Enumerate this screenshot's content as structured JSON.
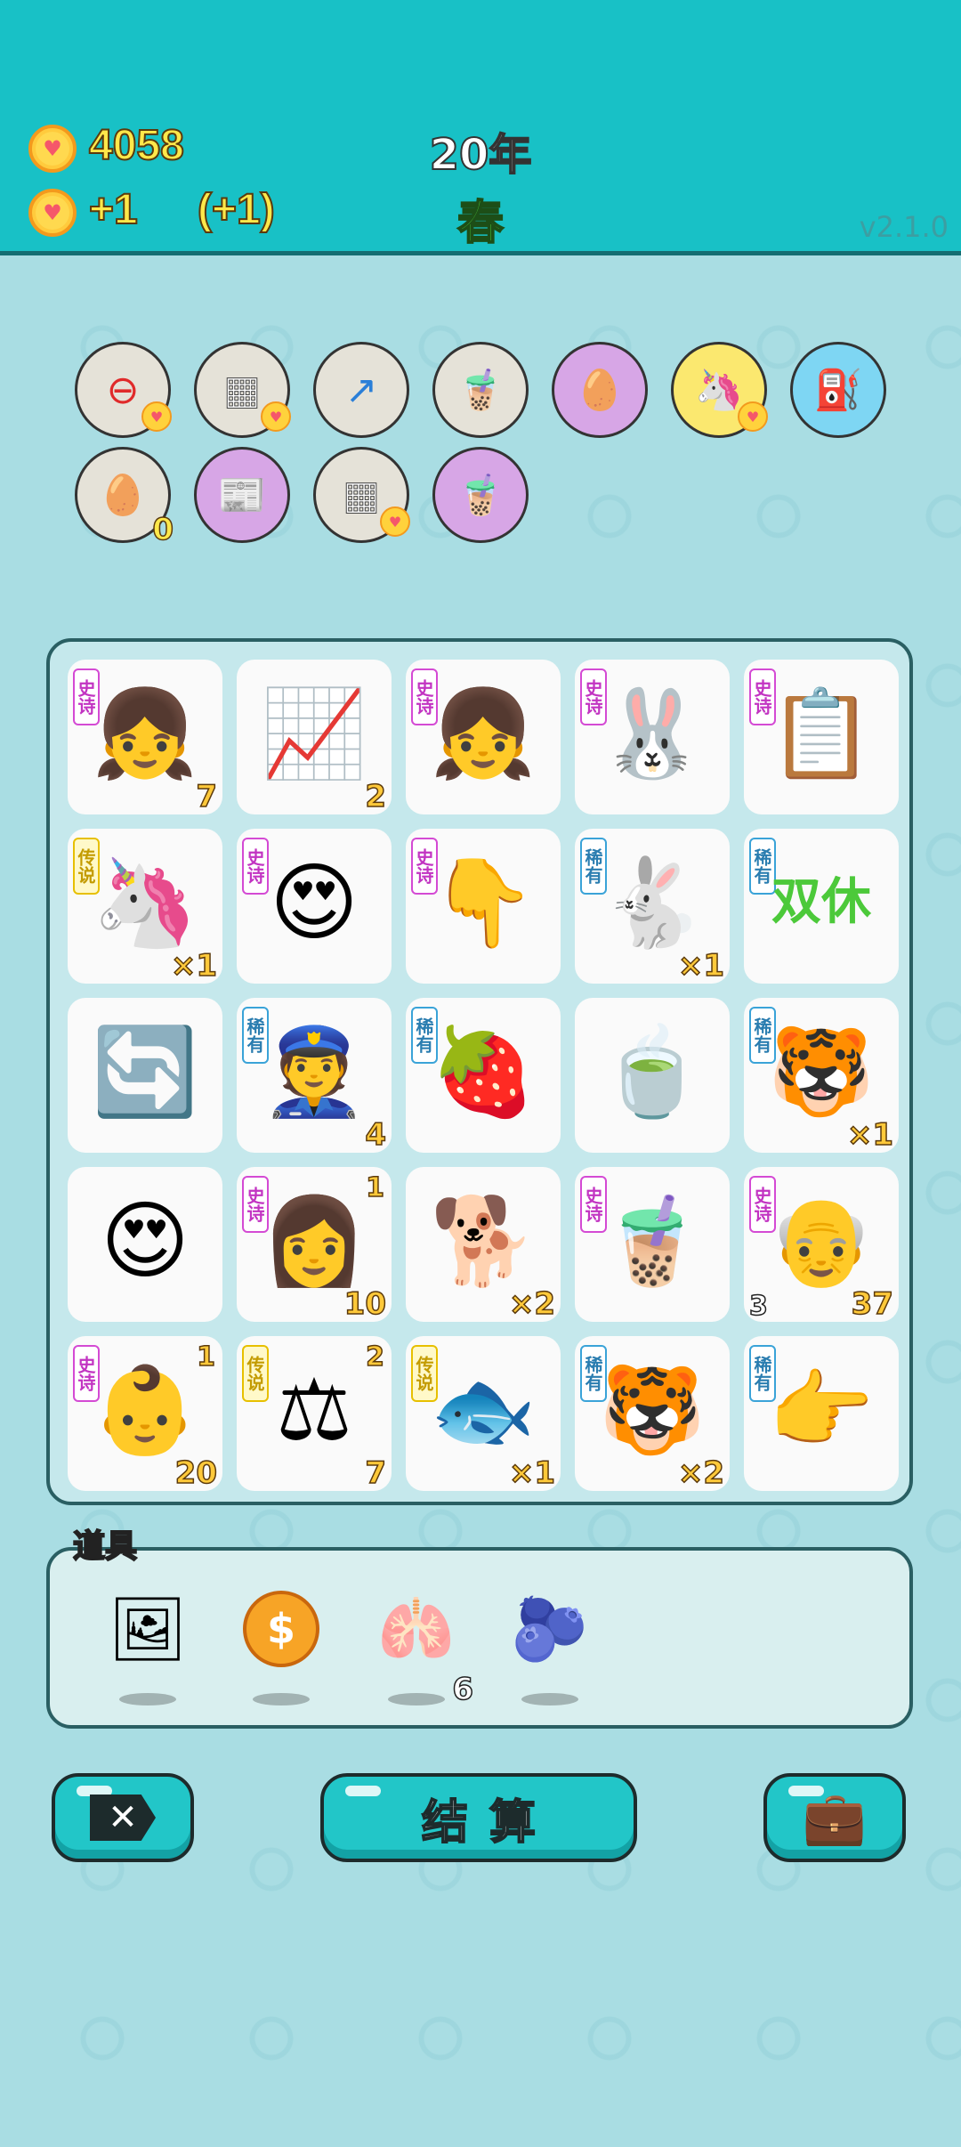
{
  "header": {
    "coins": "4058",
    "income": "+1",
    "income_bonus": "(+1)",
    "year": "20年",
    "season": "春",
    "version": "v2.1.0"
  },
  "symbols": [
    {
      "name": "minus-sign",
      "icon": "⊖"
    },
    {
      "name": "sugar-cubes",
      "icon": "▦"
    },
    {
      "name": "arrow-tile",
      "icon": "↗"
    },
    {
      "name": "bubble-tea-lid",
      "icon": "🧋"
    },
    {
      "name": "egg-face",
      "icon": "🥚"
    },
    {
      "name": "unicorn",
      "icon": "🦄"
    },
    {
      "name": "pump",
      "icon": "⛽"
    },
    {
      "name": "egg-tray",
      "icon": "🥚",
      "count": "0"
    },
    {
      "name": "time-magazine",
      "icon": "📰"
    },
    {
      "name": "sugar-cubes-2",
      "icon": "▦"
    },
    {
      "name": "boba-100",
      "icon": "🧋"
    }
  ],
  "board": [
    [
      {
        "tag": "史诗",
        "t": "epic",
        "e": "👧",
        "br": "7"
      },
      {
        "e": "📈",
        "br": "2"
      },
      {
        "tag": "史诗",
        "t": "epic",
        "e": "👧"
      },
      {
        "tag": "史诗",
        "t": "epic",
        "e": "🐰"
      },
      {
        "tag": "史诗",
        "t": "epic",
        "e": "📋"
      }
    ],
    [
      {
        "tag": "传说",
        "t": "leg",
        "e": "🦄",
        "br": "×1"
      },
      {
        "tag": "史诗",
        "t": "epic",
        "e": "😍"
      },
      {
        "tag": "史诗",
        "t": "epic",
        "e": "👇"
      },
      {
        "tag": "稀有",
        "t": "rare",
        "e": "🐇",
        "br": "×1"
      },
      {
        "tag": "稀有",
        "t": "rare",
        "e": "双休"
      }
    ],
    [
      {
        "e": "🔄"
      },
      {
        "tag": "稀有",
        "t": "rare",
        "e": "👮",
        "br": "4"
      },
      {
        "tag": "稀有",
        "t": "rare",
        "e": "🍓"
      },
      {
        "e": "🍵"
      },
      {
        "tag": "稀有",
        "t": "rare",
        "e": "🐯",
        "br": "×1"
      }
    ],
    [
      {
        "e": "😍"
      },
      {
        "tag": "史诗",
        "t": "epic",
        "e": "👩",
        "tr": "1",
        "br": "10"
      },
      {
        "e": "🐕",
        "br": "×2"
      },
      {
        "tag": "史诗",
        "t": "epic",
        "e": "🧋"
      },
      {
        "tag": "史诗",
        "t": "epic",
        "e": "👴",
        "bl": "3",
        "br": "37"
      }
    ],
    [
      {
        "tag": "史诗",
        "t": "epic",
        "e": "👶",
        "tr": "1",
        "br": "20"
      },
      {
        "tag": "传说",
        "t": "leg",
        "e": "⚖",
        "tr": "2",
        "br": "7"
      },
      {
        "tag": "传说",
        "t": "leg",
        "e": "🐟",
        "br": "×1"
      },
      {
        "tag": "稀有",
        "t": "rare",
        "e": "🐯",
        "br": "×2"
      },
      {
        "tag": "稀有",
        "t": "rare",
        "e": "👉"
      }
    ]
  ],
  "items_panel": {
    "title": "道具",
    "items": [
      {
        "name": "frame",
        "icon": "🖼"
      },
      {
        "name": "coin",
        "icon": "🪙"
      },
      {
        "name": "liver",
        "icon": "🫁",
        "count": "6"
      },
      {
        "name": "blueberry",
        "icon": "🫐"
      }
    ]
  },
  "buttons": {
    "settle": "结算"
  },
  "colors": {
    "header": "#18c1c6",
    "accent_yellow": "#ffe84a",
    "season_green": "#4cc93a"
  }
}
